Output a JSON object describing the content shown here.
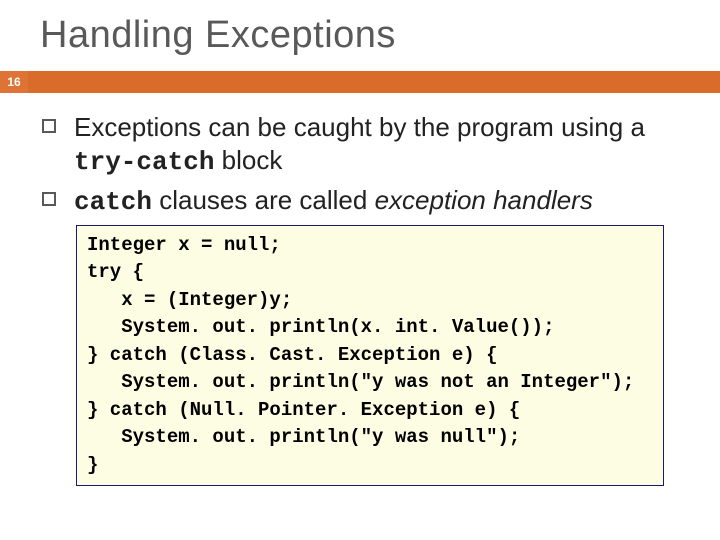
{
  "title": "Handling Exceptions",
  "slide_number": "16",
  "bullets": [
    {
      "pre": "Exceptions can be caught by the program using a ",
      "code": "try-catch",
      "post": " block"
    },
    {
      "code": "catch",
      "mid": " clauses are called ",
      "em": "exception handlers"
    }
  ],
  "code_lines": [
    "Integer x = null;",
    "try {",
    "   x = (Integer)y;",
    "   System. out. println(x. int. Value());",
    "} catch (Class. Cast. Exception e) {",
    "   System. out. println(\"y was not an Integer\");",
    "} catch (Null. Pointer. Exception e) {",
    "   System. out. println(\"y was null\");",
    "}"
  ]
}
